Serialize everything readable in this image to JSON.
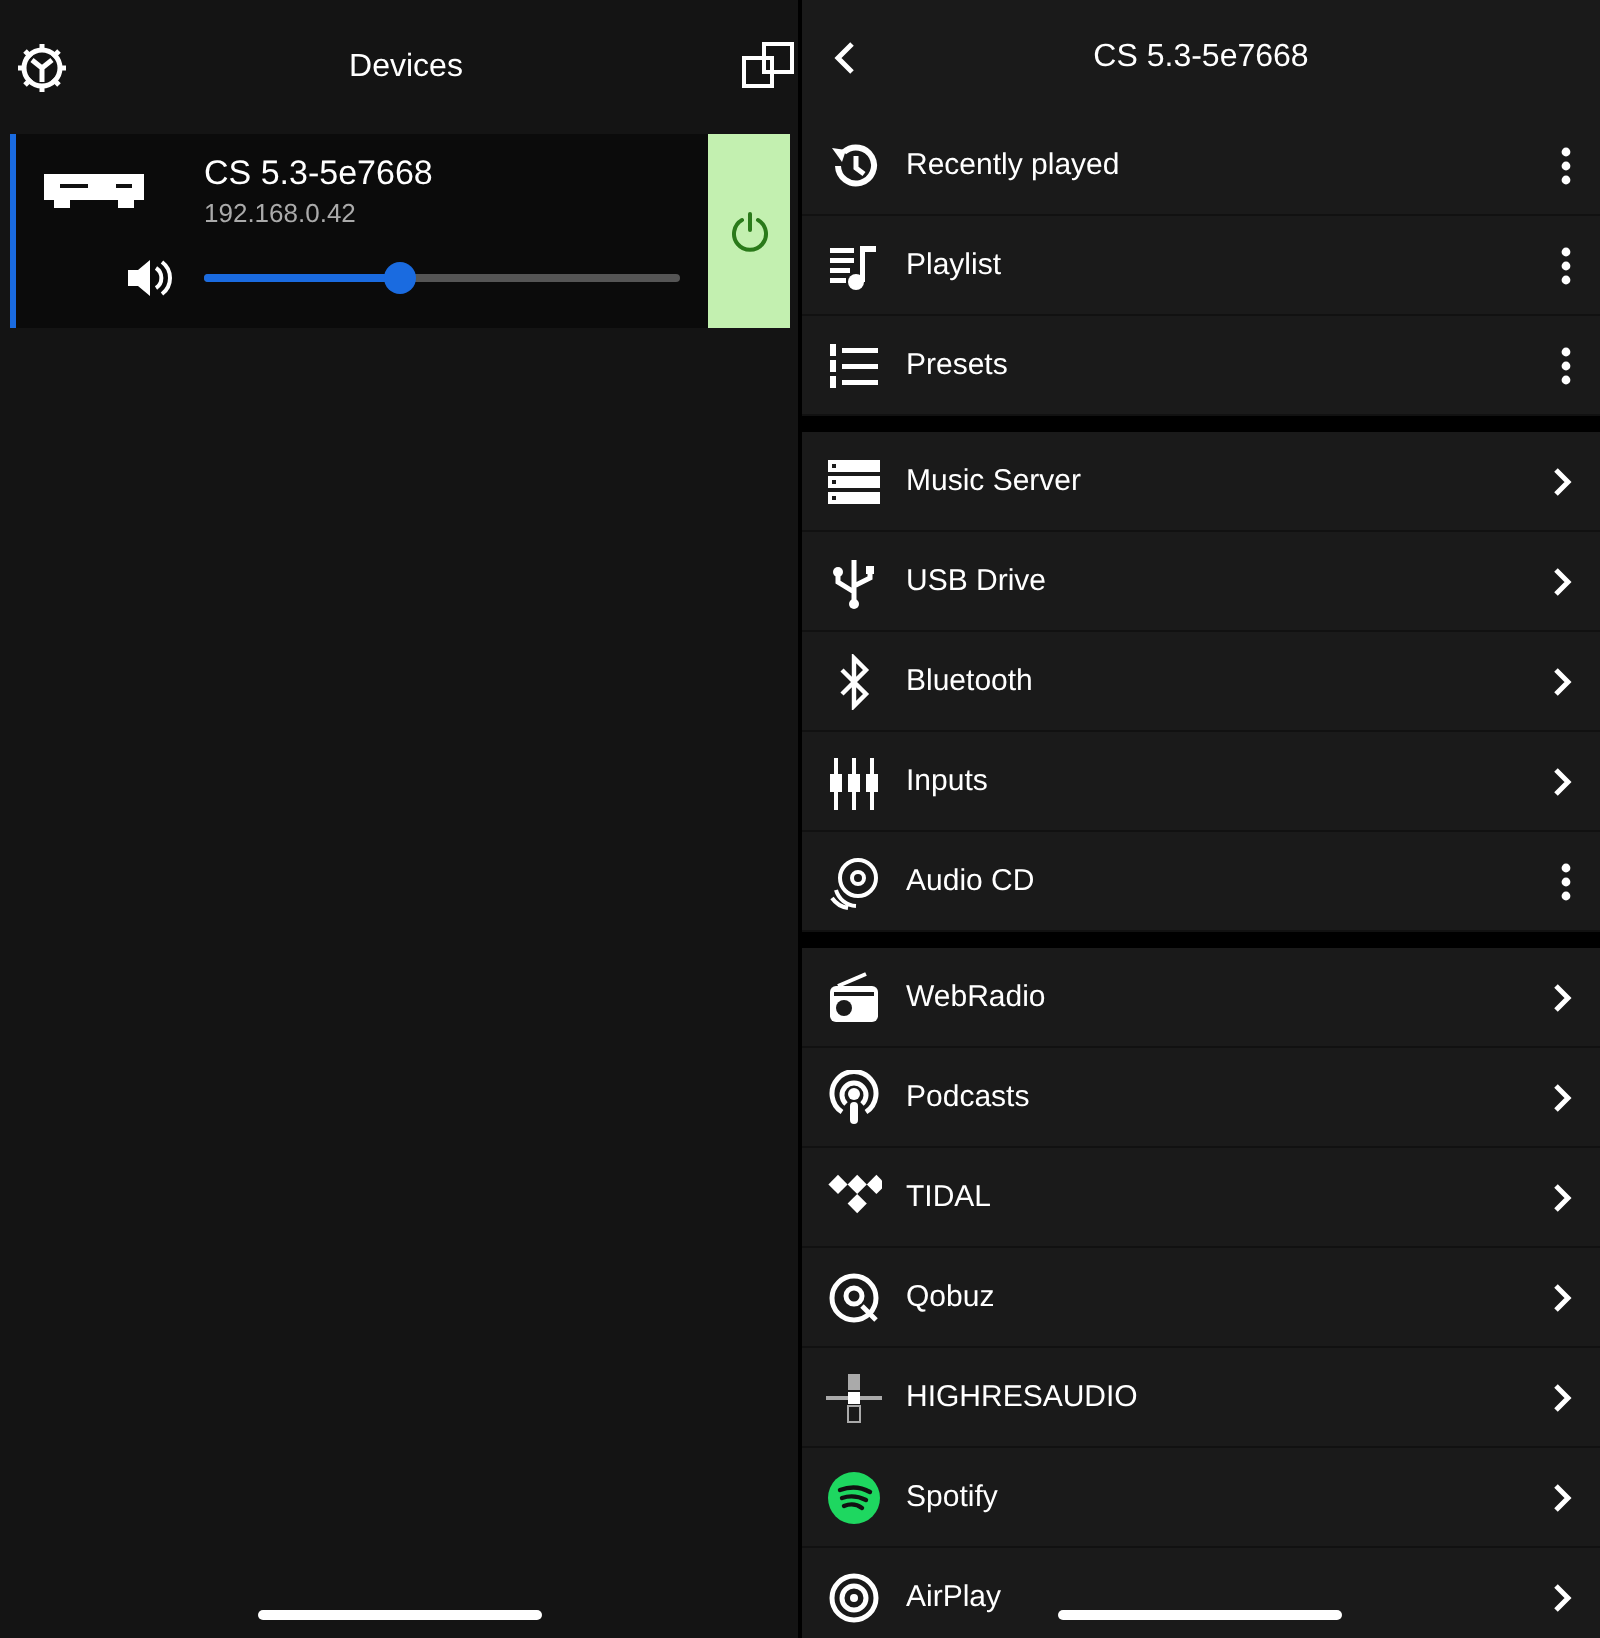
{
  "left": {
    "title": "Devices",
    "devices": [
      {
        "name": "CS 5.3-5e7668",
        "address": "192.168.0.42",
        "selected": true,
        "powered": true,
        "volume": {
          "level": 0.41
        }
      }
    ]
  },
  "right": {
    "title": "CS 5.3-5e7668",
    "sections": [
      {
        "items": [
          {
            "label": "Recently played",
            "kind": "menu"
          },
          {
            "label": "Playlist",
            "kind": "menu"
          },
          {
            "label": "Presets",
            "kind": "menu"
          }
        ]
      },
      {
        "items": [
          {
            "label": "Music Server",
            "kind": "link"
          },
          {
            "label": "USB Drive",
            "kind": "link"
          },
          {
            "label": "Bluetooth",
            "kind": "link"
          },
          {
            "label": "Inputs",
            "kind": "link"
          },
          {
            "label": "Audio CD",
            "kind": "menu"
          }
        ]
      },
      {
        "items": [
          {
            "label": "WebRadio",
            "kind": "link"
          },
          {
            "label": "Podcasts",
            "kind": "link"
          },
          {
            "label": "TIDAL",
            "kind": "link"
          },
          {
            "label": "Qobuz",
            "kind": "link"
          },
          {
            "label": "HIGHRESAUDIO",
            "kind": "link"
          },
          {
            "label": "Spotify",
            "kind": "link"
          },
          {
            "label": "AirPlay",
            "kind": "link"
          }
        ]
      }
    ]
  }
}
